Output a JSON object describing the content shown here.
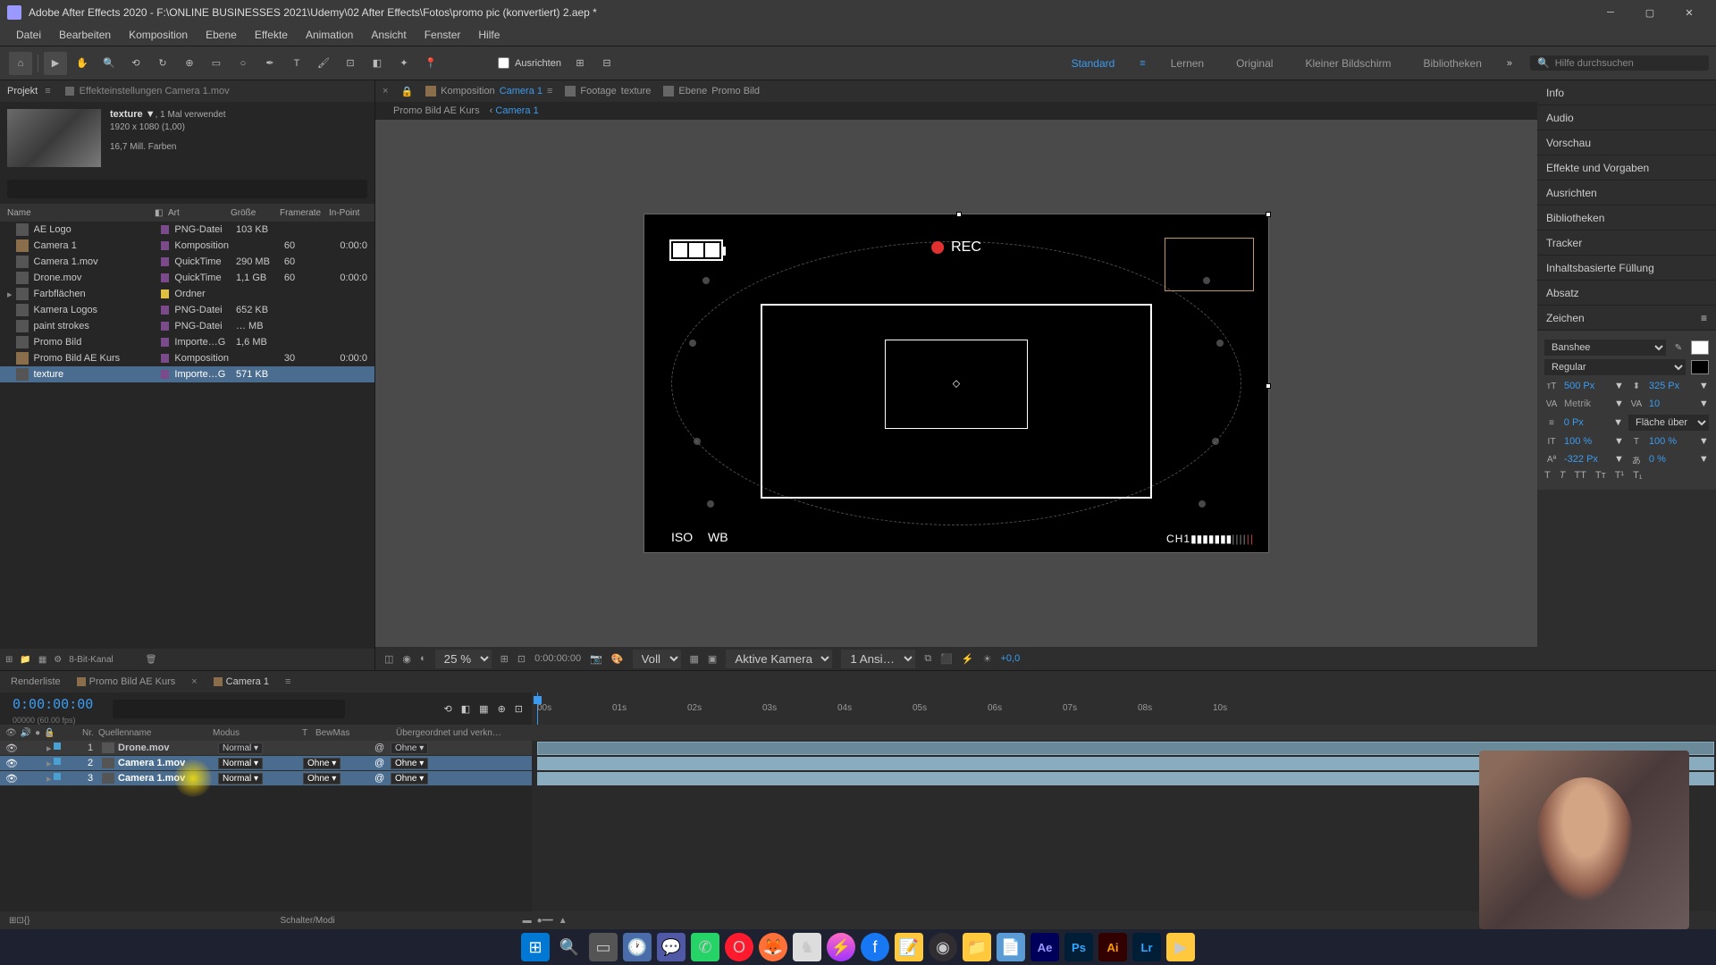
{
  "titleBar": {
    "text": "Adobe After Effects 2020 - F:\\ONLINE BUSINESSES 2021\\Udemy\\02 After Effects\\Fotos\\promo pic (konvertiert) 2.aep *"
  },
  "menu": {
    "items": [
      "Datei",
      "Bearbeiten",
      "Komposition",
      "Ebene",
      "Effekte",
      "Animation",
      "Ansicht",
      "Fenster",
      "Hilfe"
    ]
  },
  "toolbar": {
    "ausrichten": "Ausrichten",
    "workspaces": [
      "Standard",
      "Lernen",
      "Original",
      "Kleiner Bildschirm",
      "Bibliotheken"
    ],
    "searchPlaceholder": "Hilfe durchsuchen"
  },
  "project": {
    "tabLabel": "Projekt",
    "effectTab": "Effekteinstellungen Camera 1.mov",
    "preview": {
      "name": "texture ▼",
      "used": ", 1 Mal verwendet",
      "dims": "1920 x 1080 (1,00)",
      "colors": "16,7 Mill. Farben"
    },
    "columns": {
      "name": "Name",
      "art": "Art",
      "size": "Größe",
      "fr": "Framerate",
      "in": "In-Point"
    },
    "rows": [
      {
        "name": "AE Logo",
        "color": "#7a4a8a",
        "art": "PNG-Datei",
        "size": "103 KB",
        "fr": "",
        "in": ""
      },
      {
        "name": "Camera 1",
        "color": "#7a4a8a",
        "art": "Komposition",
        "size": "",
        "fr": "60",
        "in": "0:00:0"
      },
      {
        "name": "Camera 1.mov",
        "color": "#7a4a8a",
        "art": "QuickTime",
        "size": "290 MB",
        "fr": "60",
        "in": ""
      },
      {
        "name": "Drone.mov",
        "color": "#7a4a8a",
        "art": "QuickTime",
        "size": "1,1 GB",
        "fr": "60",
        "in": "0:00:0"
      },
      {
        "name": "Farbflächen",
        "color": "#e0c040",
        "art": "Ordner",
        "size": "",
        "fr": "",
        "in": "",
        "folder": true
      },
      {
        "name": "Kamera Logos",
        "color": "#7a4a8a",
        "art": "PNG-Datei",
        "size": "652 KB",
        "fr": "",
        "in": ""
      },
      {
        "name": "paint strokes",
        "color": "#7a4a8a",
        "art": "PNG-Datei",
        "size": "… MB",
        "fr": "",
        "in": ""
      },
      {
        "name": "Promo Bild",
        "color": "#7a4a8a",
        "art": "Importe…G",
        "size": "1,6 MB",
        "fr": "",
        "in": ""
      },
      {
        "name": "Promo Bild AE Kurs",
        "color": "#7a4a8a",
        "art": "Komposition",
        "size": "",
        "fr": "30",
        "in": "0:00:0"
      },
      {
        "name": "texture",
        "color": "#7a4a8a",
        "art": "Importe…G",
        "size": "571 KB",
        "fr": "",
        "in": "",
        "selected": true
      }
    ],
    "footer": {
      "bpc": "8-Bit-Kanal"
    }
  },
  "viewer": {
    "tabs": {
      "comp": "Komposition",
      "compName": "Camera 1",
      "footage": "Footage",
      "footageName": "texture",
      "layer": "Ebene",
      "layerName": "Promo Bild"
    },
    "breadcrumb": {
      "a": "Promo Bild AE Kurs",
      "b": "Camera 1"
    },
    "hud": {
      "rec": "REC",
      "iso": "ISO",
      "wb": "WB",
      "ch": "CH1"
    },
    "footer": {
      "zoom": "25 %",
      "tc": "0:00:00:00",
      "res": "Voll",
      "camera": "Aktive Kamera",
      "views": "1 Ansi…",
      "exposure": "+0,0"
    }
  },
  "rightPanels": {
    "labels": [
      "Info",
      "Audio",
      "Vorschau",
      "Effekte und Vorgaben",
      "Ausrichten",
      "Bibliotheken",
      "Tracker",
      "Inhaltsbasierte Füllung",
      "Absatz",
      "Zeichen"
    ],
    "char": {
      "font": "Banshee",
      "style": "Regular",
      "size": "500 Px",
      "leading": "325 Px",
      "kerning": "Metrik",
      "tracking": "10",
      "stroke": "0 Px",
      "strokeMode": "Fläche über Kon…",
      "vscale": "100 %",
      "hscale": "100 %",
      "baseline": "-322 Px",
      "tsume": "0 %"
    }
  },
  "timeline": {
    "tabs": {
      "render": "Renderliste",
      "comp1": "Promo Bild AE Kurs",
      "comp2": "Camera 1"
    },
    "timecode": "0:00:00:00",
    "tcSub": "00000 (60.00 fps)",
    "columns": {
      "nr": "Nr.",
      "quelle": "Quellenname",
      "modus": "Modus",
      "t": "T",
      "bew": "BewMas",
      "parent": "Übergeordnet und verkn…"
    },
    "ruler": [
      "00s",
      "01s",
      "02s",
      "03s",
      "04s",
      "05s",
      "06s",
      "07s",
      "08s",
      "10s"
    ],
    "layers": [
      {
        "nr": "1",
        "name": "Drone.mov",
        "mode": "Normal",
        "trk": "",
        "parent": "Ohne",
        "sel": false
      },
      {
        "nr": "2",
        "name": "Camera 1.mov",
        "mode": "Normal",
        "trk": "Ohne",
        "parent": "Ohne",
        "sel": true
      },
      {
        "nr": "3",
        "name": "Camera 1.mov",
        "mode": "Normal",
        "trk": "Ohne",
        "parent": "Ohne",
        "sel": true
      }
    ],
    "footer": "Schalter/Modi"
  },
  "taskbar": {
    "icons": [
      "win",
      "search",
      "tasks",
      "clock",
      "teams",
      "whatsapp",
      "opera",
      "firefox",
      "app1",
      "messenger",
      "facebook",
      "notes",
      "obs",
      "files",
      "edit",
      "ae",
      "ps",
      "ai",
      "lr",
      "more"
    ]
  }
}
